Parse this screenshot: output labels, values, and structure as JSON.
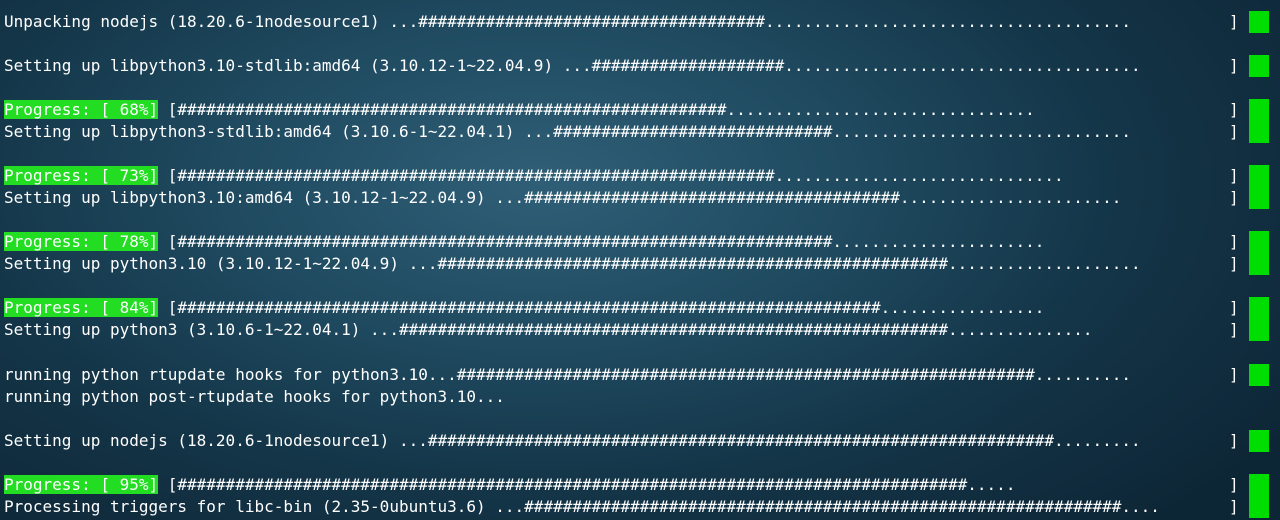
{
  "terminal": {
    "accent_color": "#22dd22",
    "cursor_color": "#00dd00",
    "lines": [
      {
        "text": "Unpacking nodejs (18.20.6-1nodesource1) ...####################################......................................",
        "bracket": "]"
      },
      {
        "text": "Setting up libpython3.10-stdlib:amd64 (3.10.12-1~22.04.9) ...####################.....................................",
        "bracket": "]"
      },
      {
        "progress_label": "Progress: [ 68%]",
        "text": " [#########################################################................................",
        "bracket": "]"
      },
      {
        "text": "Setting up libpython3-stdlib:amd64 (3.10.6-1~22.04.1) ...#############################...............................",
        "bracket": "]"
      },
      {
        "progress_label": "Progress: [ 73%]",
        "text": " [##############################################################..............................",
        "bracket": "]"
      },
      {
        "text": "Setting up libpython3.10:amd64 (3.10.12-1~22.04.9) ...#######################################.......................",
        "bracket": "]"
      },
      {
        "progress_label": "Progress: [ 78%]",
        "text": " [####################################################################......................",
        "bracket": "]"
      },
      {
        "text": "Setting up python3.10 (3.10.12-1~22.04.9) ...#####################################################....................",
        "bracket": "]"
      },
      {
        "progress_label": "Progress: [ 84%]",
        "text": " [#########################################################################.................",
        "bracket": "]"
      },
      {
        "text": "Setting up python3 (3.10.6-1~22.04.1) ...#########################################################...............",
        "bracket": "]"
      },
      {
        "text": "running python rtupdate hooks for python3.10...############################################################..........",
        "bracket": "]"
      },
      {
        "text": "running python post-rtupdate hooks for python3.10..."
      },
      {
        "text": "Setting up nodejs (18.20.6-1nodesource1) ...#################################################################.........",
        "bracket": "]"
      },
      {
        "progress_label": "Progress: [ 95%]",
        "text": " [##################################################################################.....",
        "bracket": "]"
      },
      {
        "text": "Processing triggers for libc-bin (2.35-0ubuntu3.6) ...##############################################################....",
        "bracket": "]"
      }
    ]
  }
}
